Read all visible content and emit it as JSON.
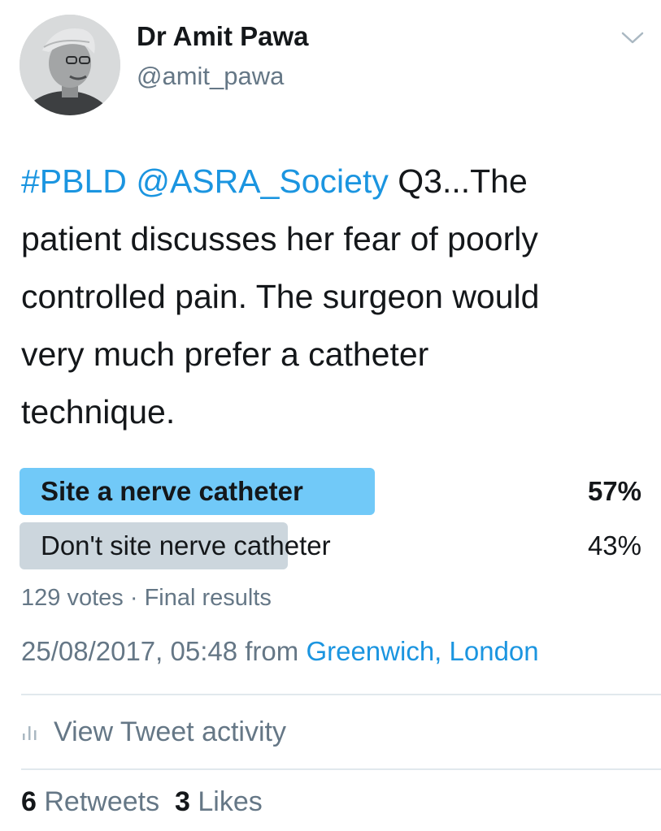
{
  "author": {
    "name": "Dr Amit Pawa",
    "handle": "@amit_pawa",
    "avatar_icon": "profile-photo"
  },
  "tweet": {
    "hashtag": "#PBLD",
    "mention": "@ASRA_Society",
    "text_line1_rest": "Q3...The",
    "text_line2": "patient discusses her fear of poorly",
    "text_line3": "controlled pain. The surgeon would",
    "text_line4": "very much prefer a catheter",
    "text_line5": "technique."
  },
  "poll": {
    "options": [
      {
        "label": "Site a nerve catheter",
        "percent": "57%",
        "fraction": 0.57,
        "winner": true
      },
      {
        "label": "Don't site nerve catheter",
        "percent": "43%",
        "fraction": 0.43,
        "winner": false
      }
    ],
    "votes": "129 votes",
    "separator": "·",
    "status": "Final results"
  },
  "meta": {
    "timestamp": "25/08/2017, 05:48",
    "from_text": "from",
    "location": "Greenwich, London"
  },
  "activity": {
    "label": "View Tweet activity",
    "icon": "bar-chart-icon"
  },
  "stats": {
    "retweets_count": "6",
    "retweets_label": "Retweets",
    "likes_count": "3",
    "likes_label": "Likes"
  },
  "colors": {
    "winner_bar": "#71c9f8",
    "loser_bar": "#ccd6dd",
    "link": "#1b95e0",
    "muted": "#657786"
  }
}
